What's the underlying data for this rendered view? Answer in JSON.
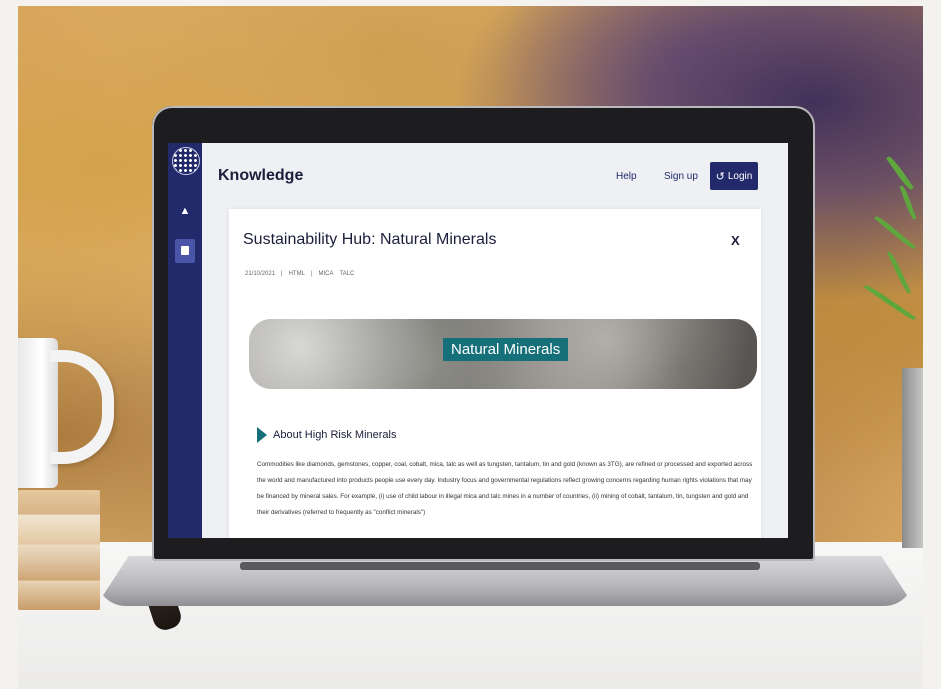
{
  "app": {
    "brand": "Knowledge",
    "nav": {
      "help": "Help",
      "signup": "Sign up",
      "login": "Login"
    }
  },
  "sidebar": {
    "items": [
      {
        "icon": "home-icon"
      },
      {
        "icon": "book-icon"
      }
    ]
  },
  "article": {
    "title": "Sustainability Hub: Natural Minerals",
    "close": "X",
    "meta": {
      "date": "21/10/2021",
      "sep": "|",
      "tags": [
        "HTML",
        "MICA",
        "TALC"
      ]
    },
    "banner_label": "Natural Minerals",
    "section_title": "About High Risk Minerals",
    "body": "Commodities like diamonds, gemstones, copper, coal, cobalt, mica, talc as well as tungsten, tantalum, tin and gold (known as 3TG), are refined or processed and exported across the world and manufactured into products people use every day. Industry focus and governmental regulations reflect growing concerns regarding human rights violations that may be financed by mineral sales. For example, (i) use of child labour in illegal mica and talc mines in a number of countries, (ii) mining of cobalt, tantalum, tin, tungsten and gold and their derivatives (referred to frequently as \"conflict minerals\")"
  },
  "colors": {
    "sidebar": "#232a6b",
    "accent": "#16707a",
    "login_bg": "#232a6b"
  }
}
